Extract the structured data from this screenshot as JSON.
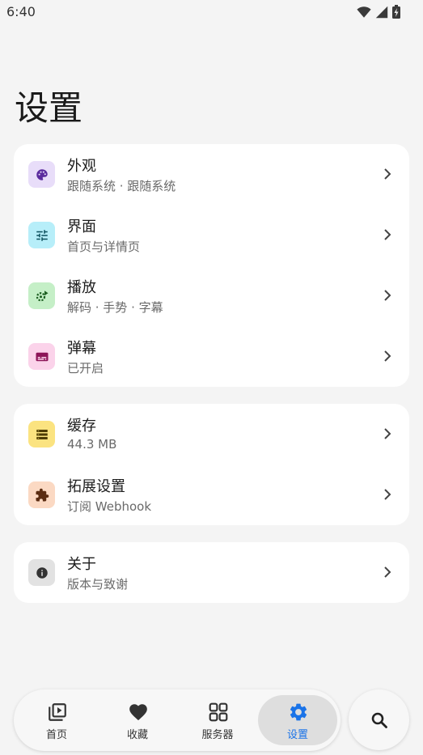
{
  "status_bar": {
    "time": "6:40"
  },
  "page": {
    "title": "设置"
  },
  "groups": [
    {
      "items": [
        {
          "title": "外观",
          "subtitle": "跟随系统 · 跟随系统",
          "icon": "palette-icon",
          "icon_bg": "#e8ddf9",
          "icon_color": "#5b2c9e"
        },
        {
          "title": "界面",
          "subtitle": "首页与详情页",
          "icon": "tune-icon",
          "icon_bg": "#b7eef9",
          "icon_color": "#0b4f5c"
        },
        {
          "title": "播放",
          "subtitle": "解码 · 手势 · 字幕",
          "icon": "play-settings-icon",
          "icon_bg": "#c5efc7",
          "icon_color": "#1b5e20"
        },
        {
          "title": "弹幕",
          "subtitle": "已开启",
          "icon": "subtitles-icon",
          "icon_bg": "#fbd3ea",
          "icon_color": "#8d1558"
        }
      ]
    },
    {
      "items": [
        {
          "title": "缓存",
          "subtitle": "44.3 MB",
          "icon": "storage-icon",
          "icon_bg": "#fbe380",
          "icon_color": "#4e3c00"
        },
        {
          "title": "拓展设置",
          "subtitle": "订阅 Webhook",
          "icon": "extension-icon",
          "icon_bg": "#fbd9c3",
          "icon_color": "#5b2c12"
        }
      ]
    },
    {
      "items": [
        {
          "title": "关于",
          "subtitle": "版本与致谢",
          "icon": "info-icon",
          "icon_bg": "#e2e2e2",
          "icon_color": "#333333"
        }
      ]
    }
  ],
  "bottom_nav": {
    "items": [
      {
        "label": "首页",
        "icon": "video-library-icon",
        "active": false
      },
      {
        "label": "收藏",
        "icon": "heart-icon",
        "active": false
      },
      {
        "label": "服务器",
        "icon": "grid-icon",
        "active": false
      },
      {
        "label": "设置",
        "icon": "gear-icon",
        "active": true
      }
    ],
    "active_color": "#1a73e8"
  },
  "search_button": {
    "icon": "search-icon"
  }
}
